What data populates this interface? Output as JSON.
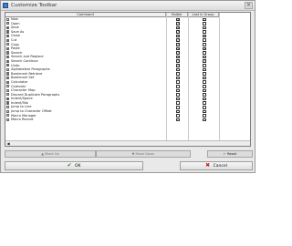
{
  "window": {
    "title": "Customize Toolbar",
    "close_glyph": "×"
  },
  "grid": {
    "headers": {
      "command": "Command",
      "visible": "Visible",
      "last_in_group": "Last in Group"
    },
    "rows": [
      {
        "label": "New",
        "icon": "new-file-icon",
        "color": "#f2f2f2",
        "visible": true,
        "last": false
      },
      {
        "label": "Open",
        "icon": "open-folder-icon",
        "color": "#e6b94a",
        "visible": true,
        "last": false
      },
      {
        "label": "Save",
        "icon": "save-icon",
        "color": "#3f6fb3",
        "visible": true,
        "last": false
      },
      {
        "label": "Save As",
        "icon": "save-as-icon",
        "color": "#3f6fb3",
        "visible": true,
        "last": false
      },
      {
        "label": "Close",
        "icon": "close-doc-icon",
        "color": "#c83a3a",
        "visible": true,
        "last": true
      },
      {
        "label": "Cut",
        "icon": "cut-icon",
        "color": "#8a8a8a",
        "visible": true,
        "last": false
      },
      {
        "label": "Copy",
        "icon": "copy-icon",
        "color": "#cfcfcf",
        "visible": true,
        "last": false
      },
      {
        "label": "Paste",
        "icon": "paste-icon",
        "color": "#b48b4a",
        "visible": true,
        "last": true
      },
      {
        "label": "Search",
        "icon": "search-icon",
        "color": "#4a7fbf",
        "visible": true,
        "last": false
      },
      {
        "label": "Search and Replace",
        "icon": "search-replace-icon",
        "color": "#4a7fbf",
        "visible": true,
        "last": false
      },
      {
        "label": "Search Continue",
        "icon": "search-continue-icon",
        "color": "#4a7fbf",
        "visible": true,
        "last": true
      },
      {
        "label": "Undo",
        "icon": "undo-icon",
        "color": "#3a8a3a",
        "visible": true,
        "last": false
      },
      {
        "label": "Alphabetize Paragraphs",
        "icon": "alphabetize-icon",
        "color": "#dcdcdc",
        "visible": false,
        "last": false
      },
      {
        "label": "Bookmark Retrieve",
        "icon": "bookmark-retrieve-icon",
        "color": "#7a7ab8",
        "visible": false,
        "last": false
      },
      {
        "label": "Bookmark Set",
        "icon": "bookmark-set-icon",
        "color": "#7a7ab8",
        "visible": false,
        "last": false
      },
      {
        "label": "Calculator",
        "icon": "calculator-icon",
        "color": "#8a8a8a",
        "visible": false,
        "last": false
      },
      {
        "label": "Calendar",
        "icon": "calendar-icon",
        "color": "#d8d8d8",
        "visible": false,
        "last": false
      },
      {
        "label": "Character Map",
        "icon": "character-map-icon",
        "color": "#d8d8d8",
        "visible": false,
        "last": false
      },
      {
        "label": "Discard Duplicate Paragraphs",
        "icon": "discard-duplicates-icon",
        "color": "#d8d8d8",
        "visible": false,
        "last": false
      },
      {
        "label": "Indent/Space",
        "icon": "indent-space-icon",
        "color": "#5a5a9a",
        "visible": false,
        "last": false
      },
      {
        "label": "Indent/Tab",
        "icon": "indent-tab-icon",
        "color": "#5a5a9a",
        "visible": false,
        "last": false
      },
      {
        "label": "Jump to Line",
        "icon": "jump-line-icon",
        "color": "#d8d8d8",
        "visible": false,
        "last": false
      },
      {
        "label": "Jump to Character Offset",
        "icon": "jump-offset-icon",
        "color": "#d8d8d8",
        "visible": false,
        "last": false
      },
      {
        "label": "Macro Manager",
        "icon": "macro-manager-icon",
        "color": "#d8d8d8",
        "visible": false,
        "last": false
      },
      {
        "label": "Macro Record",
        "icon": "macro-record-icon",
        "color": "#d8d8d8",
        "visible": false,
        "last": false
      }
    ]
  },
  "buttons": {
    "move_up": "▲ Move Up",
    "move_down": "▼ Move Down",
    "reset": "Reset",
    "reset_glyph": "←",
    "ok": "OK",
    "ok_glyph": "✔",
    "cancel": "Cancel",
    "cancel_glyph": "✖"
  },
  "check_glyph": "✓",
  "colors": {
    "ok_green": "#2a8a2a",
    "cancel_red": "#c02020"
  }
}
